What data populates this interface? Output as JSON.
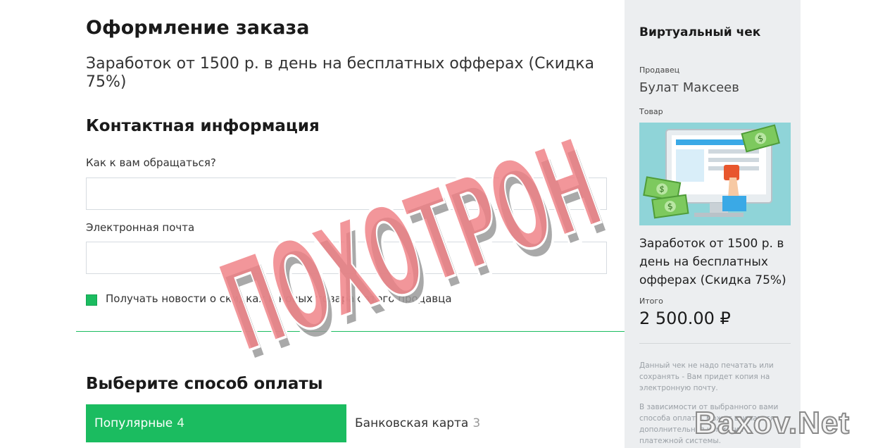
{
  "checkout": {
    "page_title": "Оформление заказа",
    "product_title": "Заработок от 1500 р. в день на бесплатных офферах (Скидка 75%)",
    "contact_title": "Контактная информация",
    "name_label": "Как к вам обращаться?",
    "name_value": "",
    "email_label": "Электронная почта",
    "email_value": "",
    "newsletter_label": "Получать новости о скидках и новых товарах этого продавца",
    "newsletter_checked": true,
    "payment_title": "Выберите способ оплаты",
    "tabs": [
      {
        "label": "Популярные",
        "count": "4",
        "active": true
      },
      {
        "label": "Банковская карта",
        "count": "3",
        "active": false
      }
    ],
    "accent": "#1bbc60"
  },
  "receipt": {
    "title": "Виртуальный чек",
    "seller_label": "Продавец",
    "seller_name": "Булат Максеев",
    "product_label": "Товар",
    "product_name": "Заработок от 1500 р. в день на бесплатных офферах (Скидка 75%)",
    "total_label": "Итого",
    "total_value": "2 500.00 ₽",
    "note1": "Данный чек не надо печатать или сохранять - Вам придет копия на электронную почту.",
    "note2": "В зависимости от выбранного вами способа оплаты, может взиматься дополнительная комиссия платежной системы."
  },
  "overlay": {
    "stamp_text": "ПОХОТРОН",
    "watermark": "Baxov.Net"
  }
}
